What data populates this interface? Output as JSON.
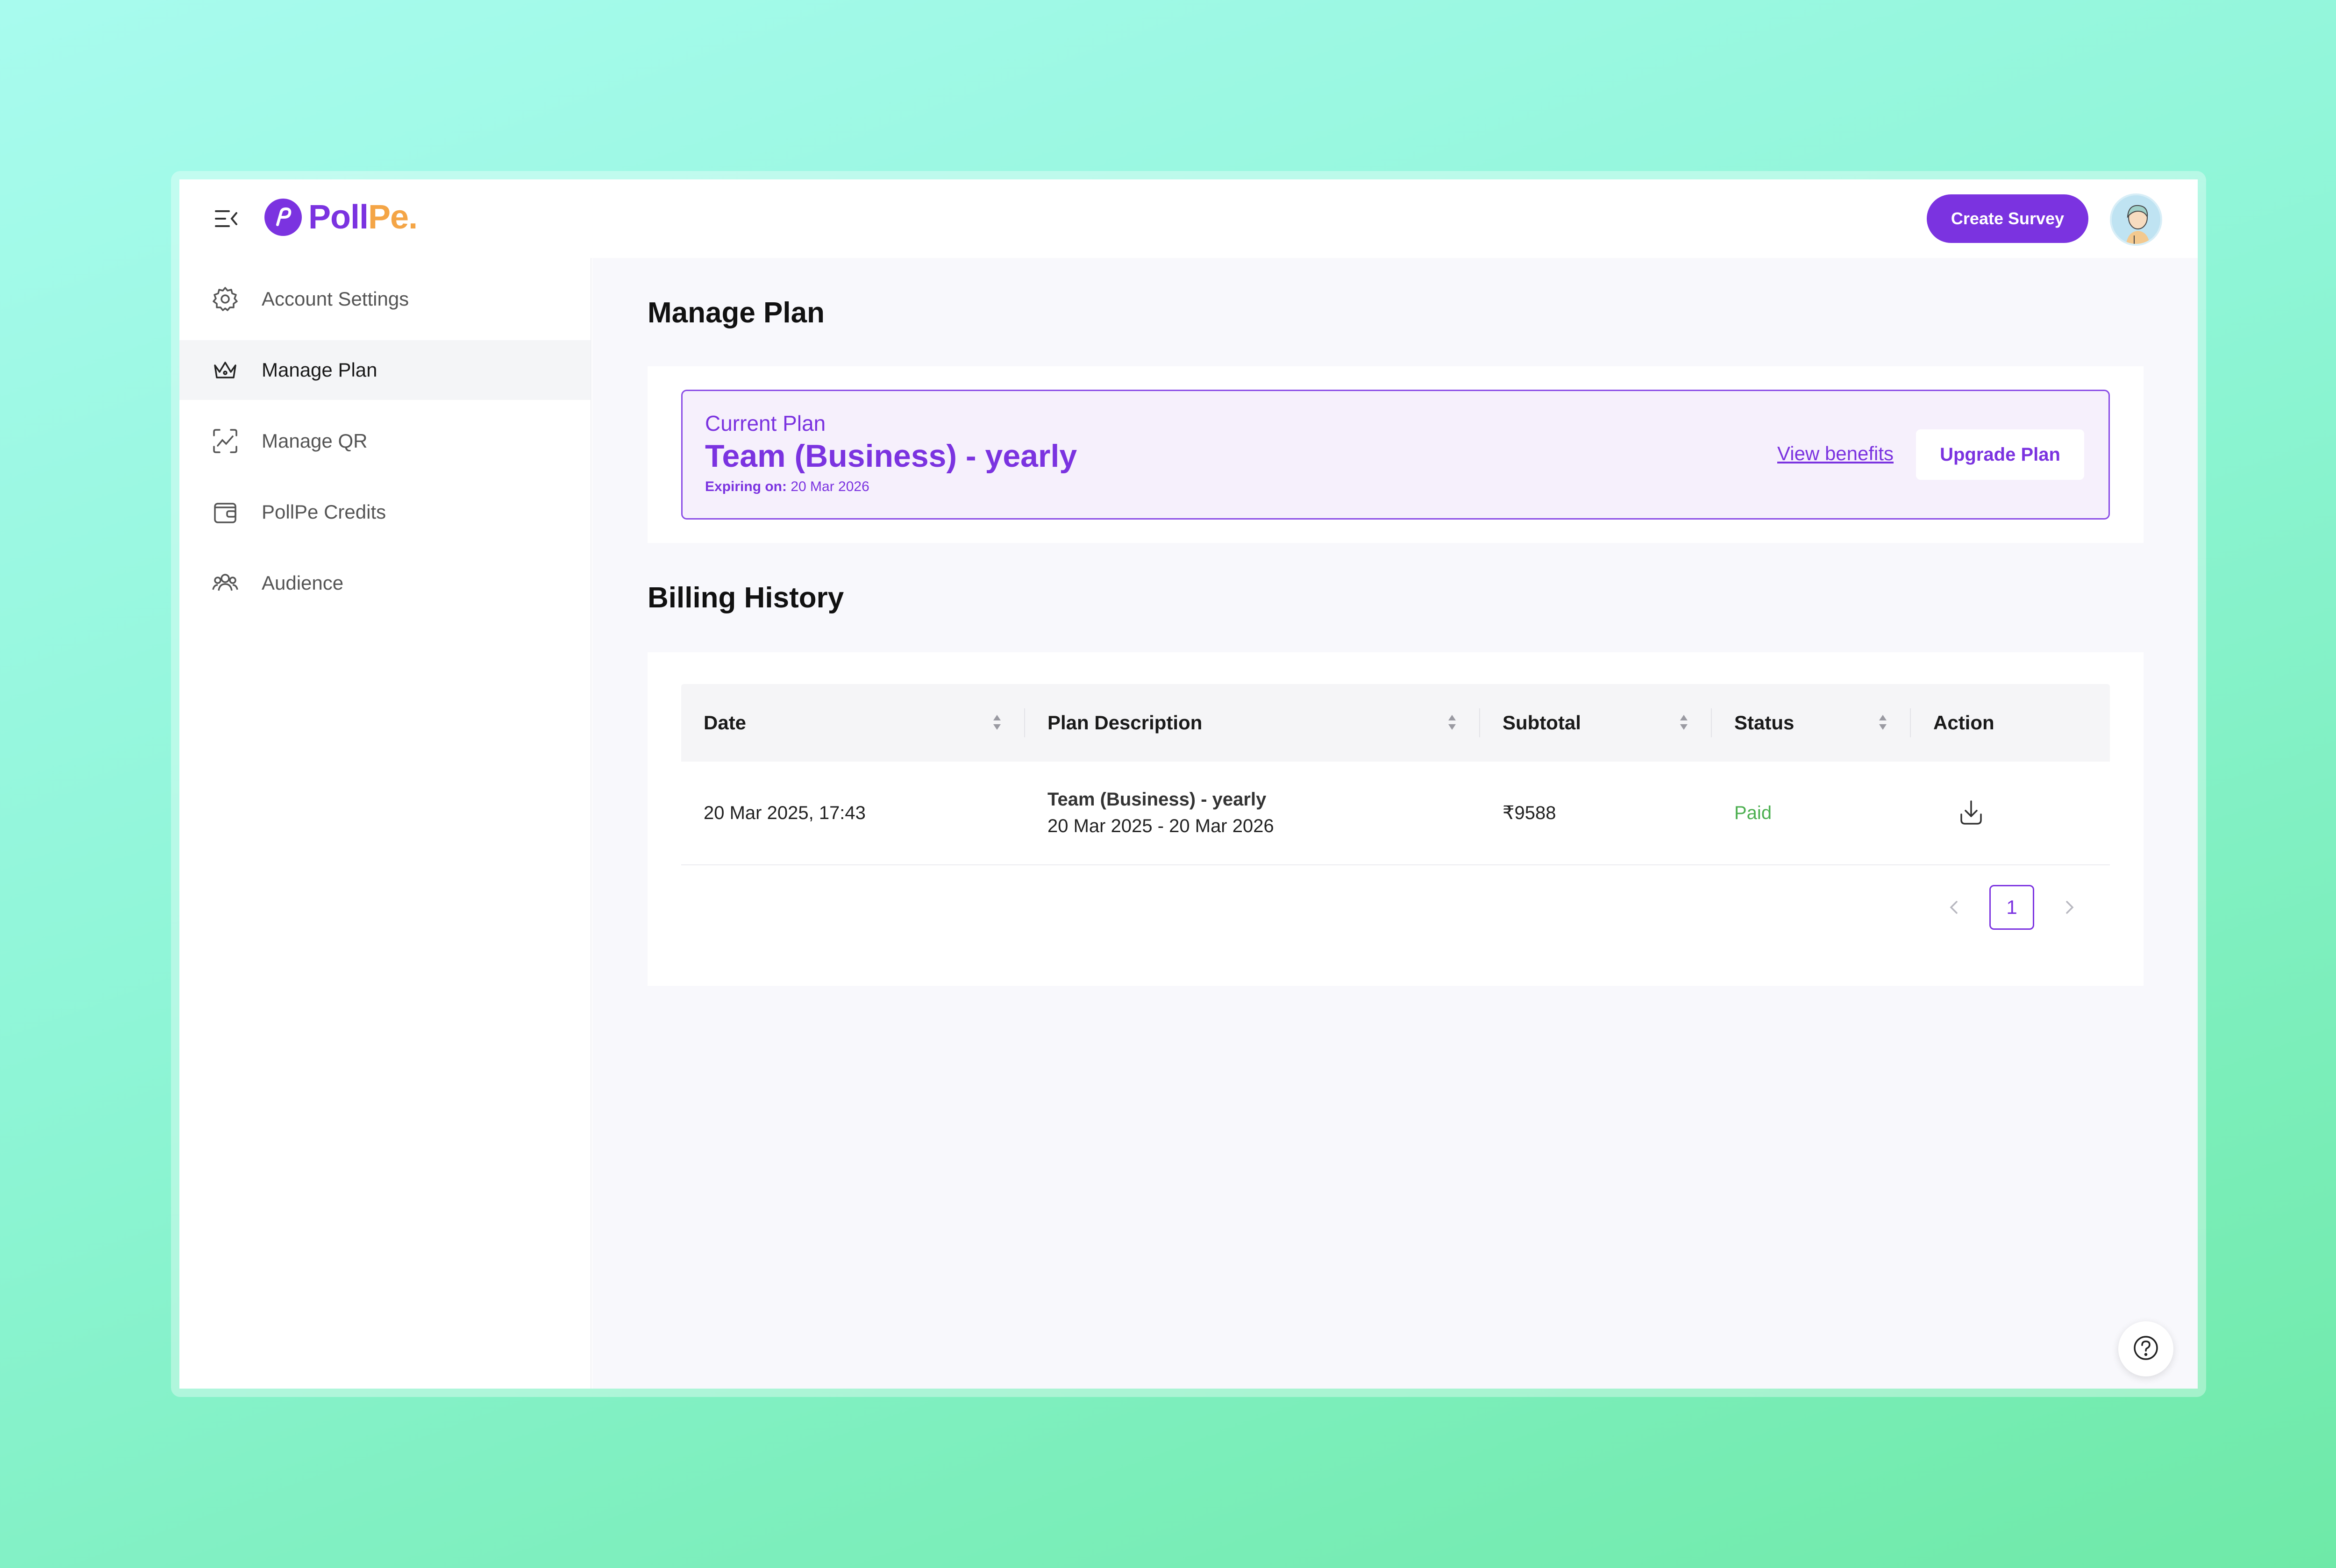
{
  "header": {
    "logo_poll": "Poll",
    "logo_pe": "Pe.",
    "create_label": "Create Survey"
  },
  "sidebar": {
    "items": [
      {
        "label": "Account Settings",
        "icon": "gear-icon"
      },
      {
        "label": "Manage Plan",
        "icon": "crown-icon",
        "active": true
      },
      {
        "label": "Manage QR",
        "icon": "qr-scan-icon"
      },
      {
        "label": "PollPe Credits",
        "icon": "wallet-icon"
      },
      {
        "label": "Audience",
        "icon": "users-icon"
      }
    ]
  },
  "main": {
    "title": "Manage Plan",
    "plan": {
      "label": "Current Plan",
      "name": "Team (Business) - yearly",
      "expiring_label": "Expiring on:",
      "expiring_date": "20 Mar 2026",
      "view_benefits": "View benefits",
      "upgrade": "Upgrade Plan"
    },
    "billing_title": "Billing History",
    "table": {
      "headers": [
        "Date",
        "Plan Description",
        "Subtotal",
        "Status",
        "Action"
      ],
      "rows": [
        {
          "date": "20 Mar 2025, 17:43",
          "plan": "Team (Business) - yearly",
          "period": "20 Mar 2025 - 20 Mar 2026",
          "subtotal": "₹9588",
          "status": "Paid"
        }
      ]
    },
    "pagination": {
      "current": "1"
    }
  },
  "colors": {
    "accent": "#7b33e0",
    "logo_secondary": "#f4a546",
    "status_paid": "#4caf50"
  }
}
